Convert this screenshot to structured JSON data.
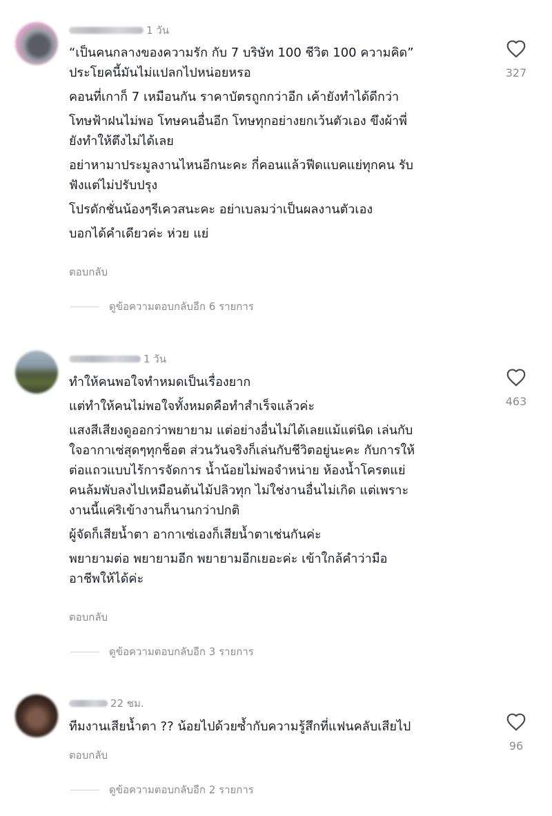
{
  "comments": [
    {
      "time": "1 วัน",
      "lines": [
        "“เป็นคนกลางของความรัก กับ 7 บริษัท 100 ชีวิต 100 ความคิด”\nประโยคนี้มันไม่แปลกไปหน่อยหรอ",
        "คอนที่เกาก็ 7 เหมือนกัน ราคาบัตรถูกกว่าอีก เค้ายังทำได้ดีกว่า",
        "โทษฟ้าฝนไม่พอ โทษคนอื่นอีก โทษทุกอย่างยกเว้นตัวเอง ขึงผ้าพี่\nยังทำให้ตึงไม่ได้เลย",
        "อย่าหามาประมูลงานไหนอีกนะคะ กี่คอนแล้วฟีดแบคแย่ทุกคน รับ\nฟังแต่ไม่ปรับปรุง",
        "โปรดักชั่นน้องๆรีเควสนะคะ อย่าเบลมว่าเป็นผลงานตัวเอง",
        "บอกได้คำเดียวค่ะ ห่วย แย่"
      ],
      "reply_label": "ตอบกลับ",
      "view_replies": "ดูข้อความตอบกลับอีก 6 รายการ",
      "likes": "327"
    },
    {
      "time": "1 วัน",
      "lines": [
        "ทำให้คนพอใจทำหมดเป็นเรื่องยาก",
        "แต่ทำให้คนไม่พอใจทั้งหมดคือทำสำเร็จแล้วค่ะ",
        "แสงสีเสียงดูออกว่าพยายาม แต่อย่างอื่นไม่ได้เลยแม้แต่นิด เล่นกับ\nใจอากาเซ่สุดๆทุกช็อต ส่วนวันจริงก็เล่นกับชีวิตอยู่นะคะ กับการให้\nต่อแถวแบบไร้การจัดการ น้ำน้อยไม่พอจำหน่าย ห้องน้ำโครตแย่\nคนล้มพับลงไปเหมือนต้นไม้ปลิวทุก ไม่ใช่งานอื่นไม่เกิด แต่เพราะ\nงานนี้แค่ริเข้างานก็นานกว่าปกติ",
        "ผู้จัดก็เสียน้ำตา อากาเซ่เองก็เสียน้ำตาเช่นกันค่ะ",
        "พยายามต่อ พยายามอีก พยายามอีกเยอะค่ะ เข้าใกล้คำว่ามือ\nอาชีพให้ได้ค่ะ"
      ],
      "reply_label": "ตอบกลับ",
      "view_replies": "ดูข้อความตอบกลับอีก 3 รายการ",
      "likes": "463"
    },
    {
      "time": "22 ชม.",
      "lines": [
        "ทีมงานเสียน้ำตา ?? น้อยไปด้วยซ้ำกับความรู้สึกที่แฟนคลับเสียไป"
      ],
      "reply_label": "ตอบกลับ",
      "view_replies": "ดูข้อความตอบกลับอีก 2 รายการ",
      "likes": "96"
    }
  ],
  "icons": {
    "like": "heart-outline-icon"
  },
  "colors": {
    "text": "#161823",
    "muted": "#8a8b91"
  }
}
